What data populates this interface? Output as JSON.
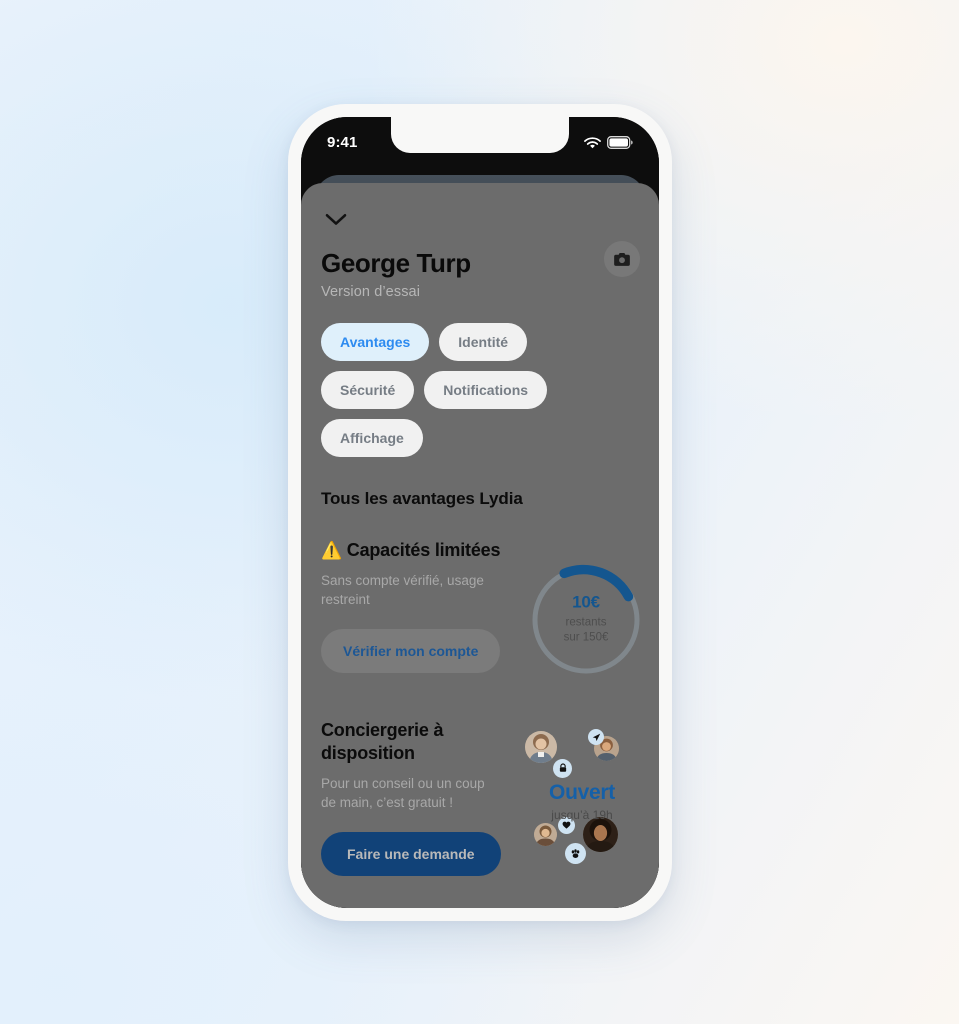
{
  "status_bar": {
    "time": "9:41",
    "wifi_icon": "wifi-icon",
    "battery_icon": "battery-icon"
  },
  "sheet": {
    "collapse_icon": "chevron-down-icon",
    "camera_icon": "camera-icon",
    "profile_name": "George Turp",
    "profile_subtitle": "Version d’essai"
  },
  "tabs": [
    {
      "label": "Avantages",
      "active": true
    },
    {
      "label": "Identité",
      "active": false
    },
    {
      "label": "Sécurité",
      "active": false
    },
    {
      "label": "Notifications",
      "active": false
    },
    {
      "label": "Affichage",
      "active": false
    }
  ],
  "section": {
    "title": "Tous les avantages Lydia"
  },
  "features": [
    {
      "warn_emoji": "⚠️",
      "title": "Capacités limitées",
      "description": "Sans compte vérifié, usage restreint",
      "button_label": "Vérifier mon compte",
      "ring": {
        "value": "10€",
        "label_line1": "restants",
        "label_line2": "sur 150€",
        "track_color": "#9aa6ad",
        "arc_color": "#14568f",
        "percent": 25
      }
    },
    {
      "title": "Conciergerie à disposition",
      "description": "Pour un conseil ou un coup de main, c’est gratuit !",
      "button_label": "Faire une demande",
      "status_title": "Ouvert",
      "status_subtitle": "jusqu’à 19h",
      "badges": [
        {
          "name": "plane-icon"
        },
        {
          "name": "lock-icon"
        },
        {
          "name": "heart-icon"
        },
        {
          "name": "paw-icon"
        }
      ]
    }
  ],
  "colors": {
    "accent_blue": "#2d8bf0",
    "deep_blue": "#114278",
    "ring_blue": "#14568f",
    "sheet_gray": "#6c6c6c",
    "pill_gray": "#f1f1f1",
    "warn_yellow": "#e8b422"
  }
}
